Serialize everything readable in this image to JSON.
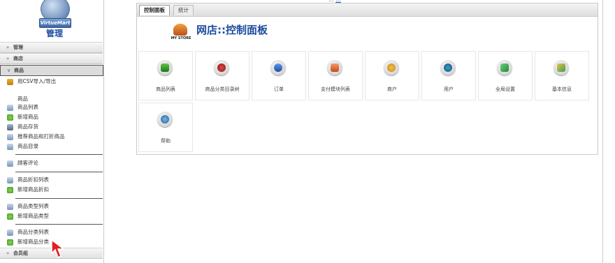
{
  "top": {
    "text": "...",
    "link": "..."
  },
  "sidebar": {
    "logo_banner": "VirtueMart",
    "logo_title": "管理",
    "headers": {
      "manage": "管理",
      "store": "商店",
      "product": "商品",
      "member": "会员组"
    },
    "csv_item": "用CSV导入/导出",
    "section_product": "商品",
    "items_product": [
      "商品列表",
      "新增商品",
      "商品存货",
      "推荐商品和打折商品",
      "商品目录"
    ],
    "items_review": [
      "顾客评论"
    ],
    "items_discount": [
      "商品折扣列表",
      "新增商品折扣"
    ],
    "items_type": [
      "商品类型列表",
      "新增商品类型"
    ],
    "items_category": [
      "商品分类列表",
      "新增商品分类"
    ]
  },
  "panel": {
    "tabs": [
      "控制面板",
      "统计"
    ],
    "store_logo_text": "MY STORE",
    "title": "网店::控制面板",
    "tiles": [
      "商品列表",
      "商品分类目录树",
      "订单",
      "支付模块列表",
      "商户",
      "用户",
      "全局设置",
      "基本信息",
      "帮助"
    ]
  }
}
